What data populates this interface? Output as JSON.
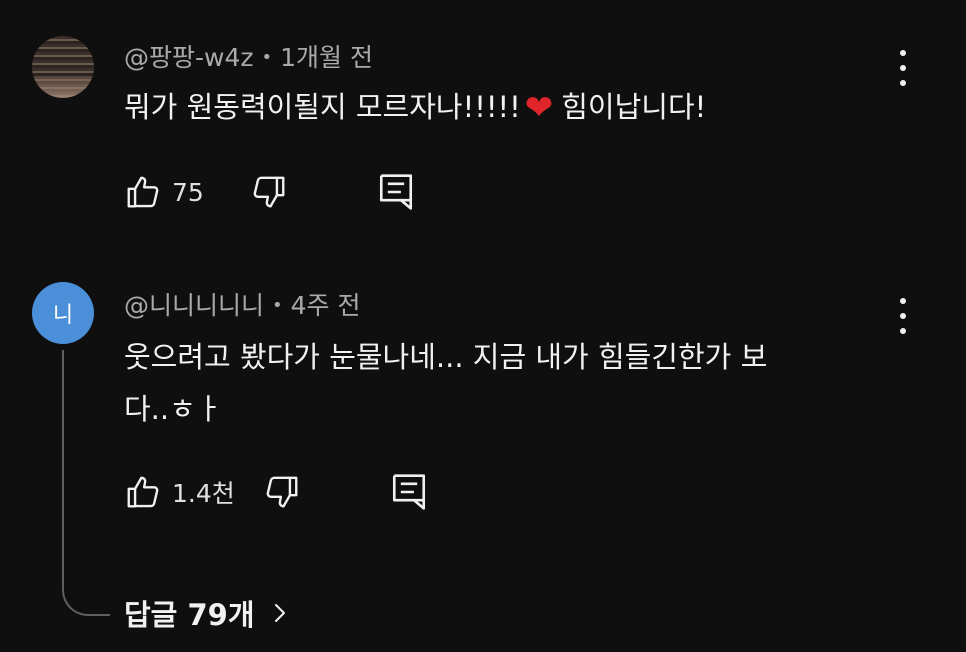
{
  "comments": [
    {
      "author": "@팡팡-w4z",
      "time": "1개월 전",
      "text_before": "뭐가 원동력이될지 모르자나!!!!!",
      "heart": "❤",
      "text_after": "힘이납니다!",
      "likes": "75",
      "avatar": "photo"
    },
    {
      "author": "@니니니니니",
      "time": "4주 전",
      "line1": "웃으려고 봤다가 눈물나네... 지금 내가 힘들긴한가 보",
      "line2": "다..ㅎㅏ",
      "likes": "1.4천",
      "avatar_letter": "니"
    }
  ],
  "separator": "•",
  "replies": {
    "label": "답글 79개"
  },
  "icons": [
    "like-icon",
    "dislike-icon",
    "reply-icon",
    "more-vert-icon",
    "chevron-right-icon"
  ],
  "colors": {
    "background": "#0f0f0f",
    "text": "#f1f1f1",
    "meta": "#aaaaaa",
    "avatar_blue": "#4a8fd8",
    "heart": "#e0262b"
  }
}
